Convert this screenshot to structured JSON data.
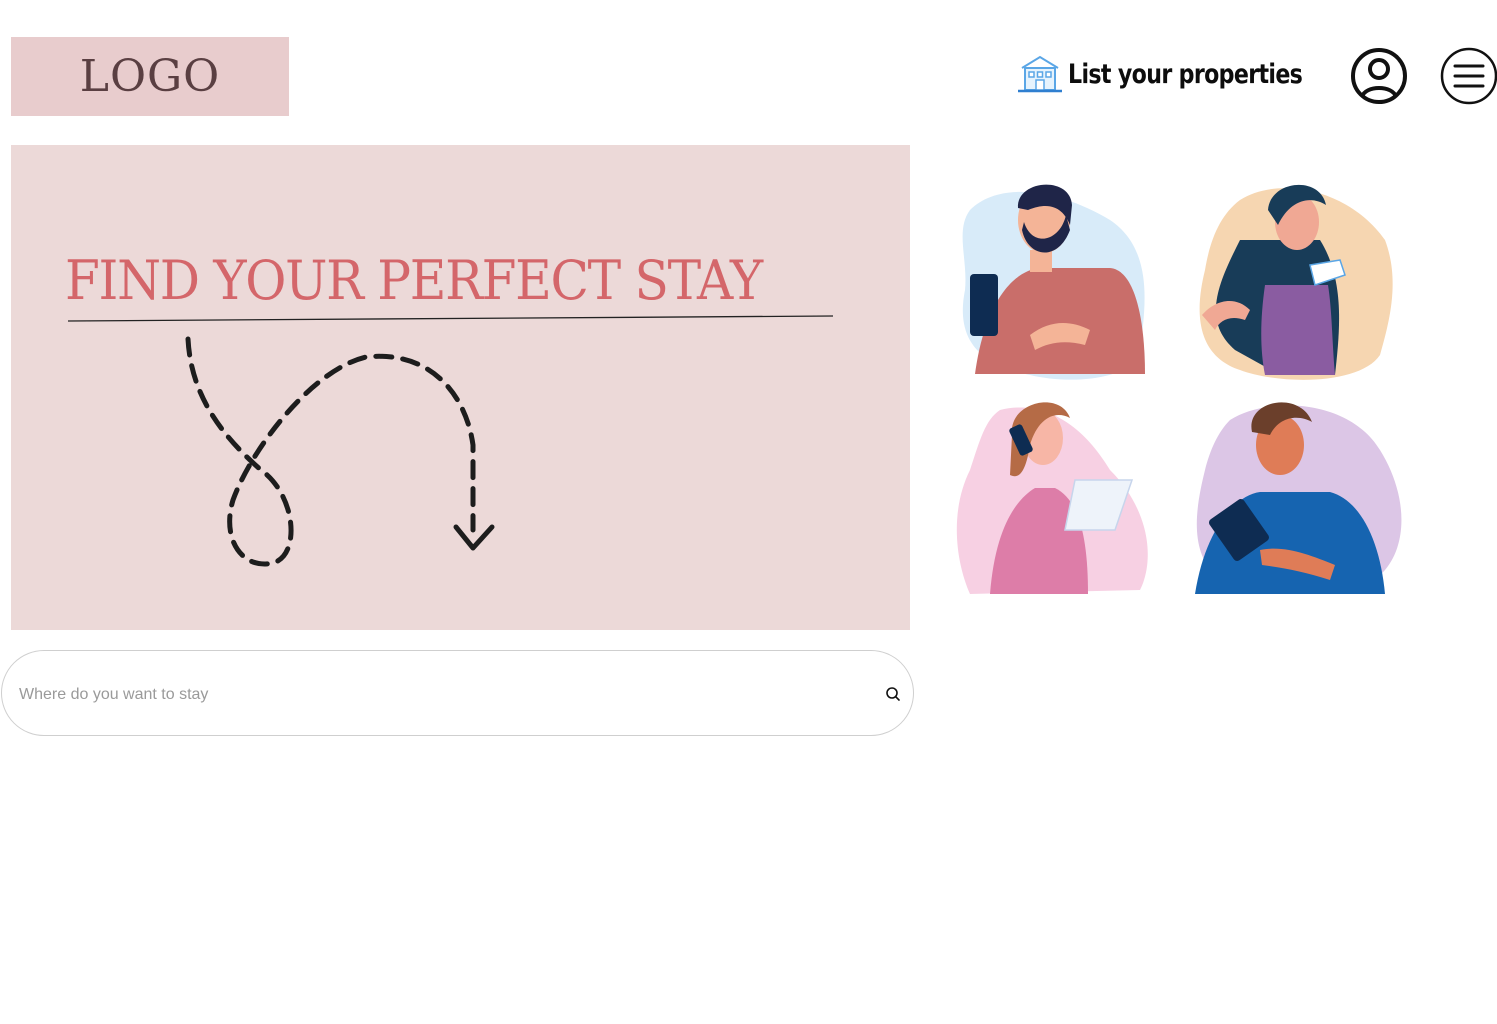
{
  "header": {
    "logo_text": "LOGO",
    "list_properties_label": "List your properties",
    "list_properties_icon": "building-icon",
    "account_icon": "user-circle-icon",
    "menu_icon": "hamburger-menu-icon"
  },
  "hero": {
    "title": "FIND YOUR PERFECT STAY",
    "decoration": "dashed-loop-arrow-icon"
  },
  "illustrations": [
    {
      "name": "man-with-phone-illustration"
    },
    {
      "name": "woman-with-phone-illustration"
    },
    {
      "name": "woman-on-call-illustration"
    },
    {
      "name": "man-with-tablet-illustration"
    }
  ],
  "search": {
    "placeholder": "Where do you want to stay",
    "value": "",
    "icon": "search-icon"
  },
  "colors": {
    "logo_bg": "#e8cccd",
    "hero_bg": "#ecd9d8",
    "accent": "#d4666a"
  }
}
